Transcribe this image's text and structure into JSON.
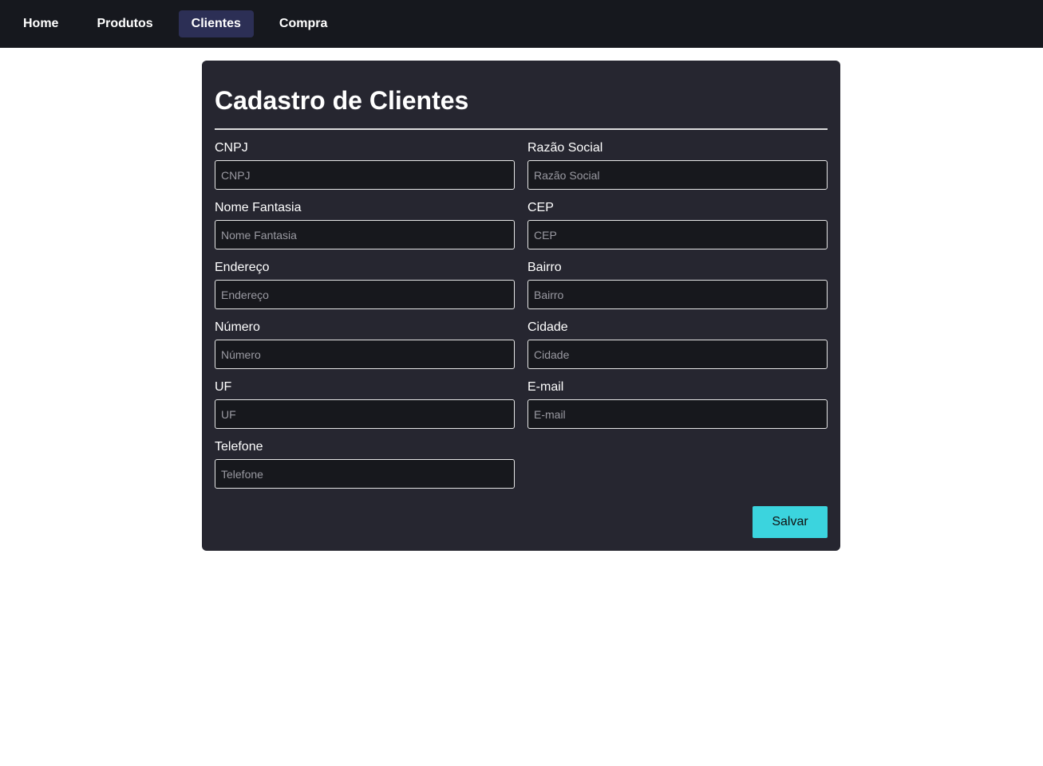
{
  "nav": {
    "items": [
      {
        "label": "Home"
      },
      {
        "label": "Produtos"
      },
      {
        "label": "Clientes",
        "active": true
      },
      {
        "label": "Compra"
      }
    ]
  },
  "form": {
    "title": "Cadastro de Clientes",
    "fields": [
      {
        "label": "CNPJ",
        "placeholder": "CNPJ",
        "value": ""
      },
      {
        "label": "Razão Social",
        "placeholder": "Razão Social",
        "value": ""
      },
      {
        "label": "Nome Fantasia",
        "placeholder": "Nome Fantasia",
        "value": ""
      },
      {
        "label": "CEP",
        "placeholder": "CEP",
        "value": ""
      },
      {
        "label": "Endereço",
        "placeholder": "Endereço",
        "value": ""
      },
      {
        "label": "Bairro",
        "placeholder": "Bairro",
        "value": ""
      },
      {
        "label": "Número",
        "placeholder": "Número",
        "value": ""
      },
      {
        "label": "Cidade",
        "placeholder": "Cidade",
        "value": ""
      },
      {
        "label": "UF",
        "placeholder": "UF",
        "value": ""
      },
      {
        "label": "E-mail",
        "placeholder": "E-mail",
        "value": ""
      },
      {
        "label": "Telefone",
        "placeholder": "Telefone",
        "value": ""
      }
    ],
    "save_label": "Salvar"
  },
  "colors": {
    "nav_bg": "#16181e",
    "active": "#2c2f55",
    "card": "#262630",
    "accent": "#3bd4de"
  }
}
